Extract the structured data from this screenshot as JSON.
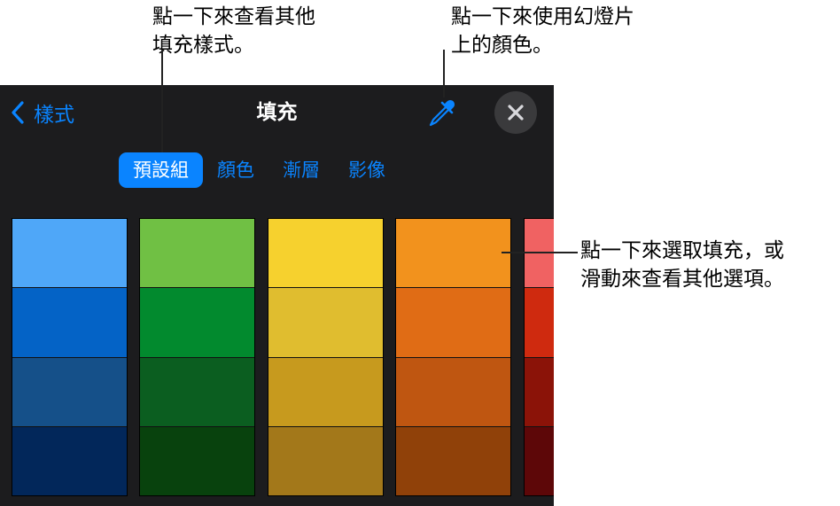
{
  "callouts": {
    "fill_styles": "點一下來查看其他\n填充樣式。",
    "eyedropper": "點一下來使用幻燈片\n上的顏色。",
    "swipe": "點一下來選取填充，或\n滑動來查看其他選項。"
  },
  "header": {
    "back_label": "樣式",
    "title": "填充"
  },
  "icons": {
    "back": "chevron-left-icon",
    "eyedropper": "eyedropper-icon",
    "close": "close-icon"
  },
  "tabs": [
    {
      "label": "預設組",
      "active": true
    },
    {
      "label": "顏色",
      "active": false
    },
    {
      "label": "漸層",
      "active": false
    },
    {
      "label": "影像",
      "active": false
    }
  ],
  "colors": {
    "accent": "#0a84ff",
    "panel_bg": "#1c1c1e",
    "close_bg": "#3a3a3c"
  },
  "swatch_columns": [
    {
      "name": "blue",
      "colors": [
        "#4fa7f8",
        "#0463c6",
        "#155089",
        "#02275a"
      ]
    },
    {
      "name": "green",
      "colors": [
        "#70c044",
        "#028a2e",
        "#0b5e20",
        "#08420d"
      ]
    },
    {
      "name": "yellow",
      "colors": [
        "#f6d12e",
        "#e0bd2f",
        "#c79a1e",
        "#a3781a"
      ]
    },
    {
      "name": "orange",
      "colors": [
        "#f2921d",
        "#e06c15",
        "#bf5611",
        "#904109"
      ]
    },
    {
      "name": "red",
      "colors": [
        "#f06262",
        "#cf2a0f",
        "#8b1308",
        "#5d0708"
      ]
    }
  ]
}
